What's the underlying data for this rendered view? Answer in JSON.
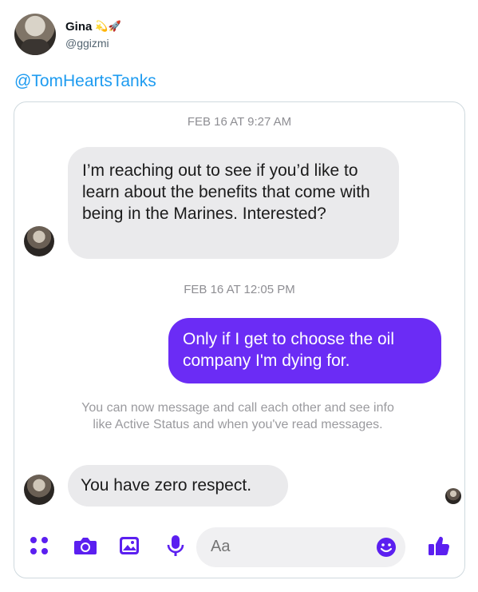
{
  "tweet": {
    "display_name": "Gina",
    "name_emojis": "💫🚀",
    "handle": "@ggizmi",
    "text": "@TomHeartsTanks"
  },
  "conversation": {
    "timestamp_1": "FEB 16 AT 9:27 AM",
    "message_1": "I’m reaching out to see if you’d like to learn about the benefits that come with being in the Marines. Interested?",
    "timestamp_2": "FEB 16 AT 12:05 PM",
    "message_2": "Only if I get to choose the oil company I'm dying for.",
    "info_note": "You can now message and call each other and see info like Active Status and when you've read messages.",
    "message_3": "You have zero respect."
  },
  "composer": {
    "placeholder": "Aa"
  },
  "colors": {
    "link_blue": "#1d9bf0",
    "outgoing_bubble": "#6b2cf5",
    "incoming_bubble": "#eaeaec",
    "toolbar_icon": "#5b1ff0"
  },
  "icons": [
    "apps-icon",
    "camera-icon",
    "gallery-icon",
    "microphone-icon",
    "emoji-icon",
    "thumbs-up-icon"
  ]
}
